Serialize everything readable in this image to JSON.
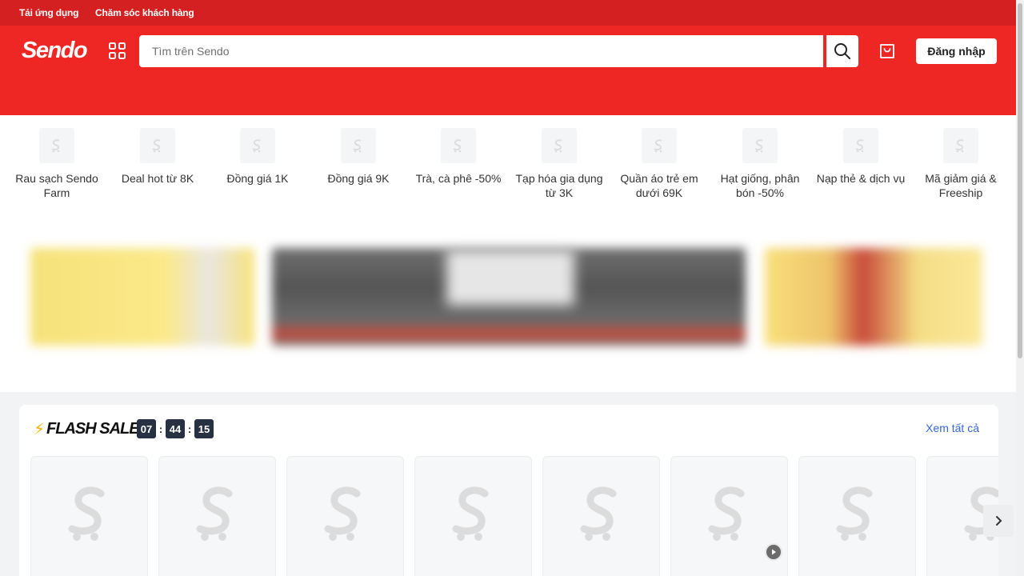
{
  "topbar": {
    "app_download": "Tải ứng dụng",
    "customer_care": "Chăm sóc khách hàng"
  },
  "header": {
    "logo": "Sendo",
    "search_placeholder": "Tìm trên Sendo",
    "login_label": "Đăng nhập"
  },
  "categories": [
    "Rau sạch Sendo Farm",
    "Deal hot từ 8K",
    "Đồng giá 1K",
    "Đồng giá 9K",
    "Trà, cà phê -50%",
    "Tạp hóa gia dụng từ 3K",
    "Quần áo trẻ em dưới 69K",
    "Hạt giống, phân bón -50%",
    "Nạp thẻ & dịch vụ",
    "Mã giảm giá & Freeship"
  ],
  "flash_sale": {
    "title": "FLASH SALE",
    "timer": {
      "hours": "07",
      "minutes": "44",
      "seconds": "15"
    },
    "see_all": "Xem tất cả",
    "product_has_video": [
      false,
      false,
      false,
      false,
      false,
      true,
      false,
      true
    ]
  },
  "colors": {
    "brand_red": "#ee2624",
    "topbar_red": "#d42020",
    "link_blue": "#3366dd",
    "timer_bg": "#273142"
  }
}
